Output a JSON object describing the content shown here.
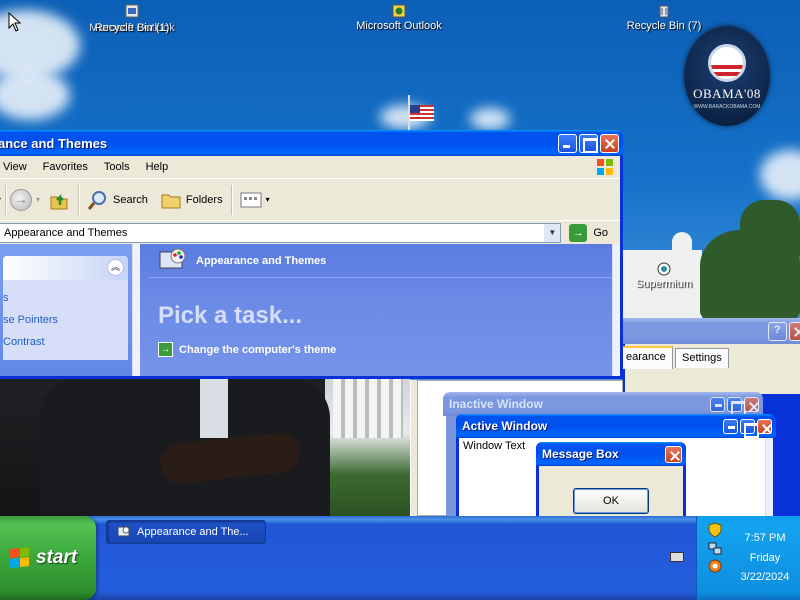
{
  "desktop": {
    "icons": [
      {
        "label": "Microsoft Outlook",
        "overlay_label": "Recycle Bin (1)"
      },
      {
        "label": "Microsoft Outlook"
      },
      {
        "label": "Recycle Bin (7)"
      },
      {
        "label": "Supermium"
      }
    ],
    "badge": {
      "text": "OBAMA'08",
      "small_text": "WWW.BARACKOBAMA.COM"
    }
  },
  "explorer": {
    "title": "ance and Themes",
    "menu": [
      "View",
      "Favorites",
      "Tools",
      "Help"
    ],
    "toolbar": {
      "search": "Search",
      "folders": "Folders"
    },
    "address": "Appearance and Themes",
    "go": "Go",
    "task_links": [
      "s",
      "se Pointers",
      "Contrast"
    ],
    "header": "Appearance and Themes",
    "pick_task": "Pick a task...",
    "change_theme": "Change the computer's theme"
  },
  "display_props": {
    "tabs": [
      "earance",
      "Settings"
    ]
  },
  "preview": {
    "inactive_title": "Inactive Window",
    "active_title": "Active Window",
    "window_text": "Window Text",
    "msgbox_title": "Message Box",
    "ok": "OK"
  },
  "taskbar": {
    "start": "start",
    "task_button": "Appearance and The...",
    "time": "7:57 PM",
    "day": "Friday",
    "date": "3/22/2024"
  },
  "colors": {
    "xp_blue": "#0831d9",
    "start_green": "#3aa73a",
    "tray_blue": "#0d8fe0"
  }
}
